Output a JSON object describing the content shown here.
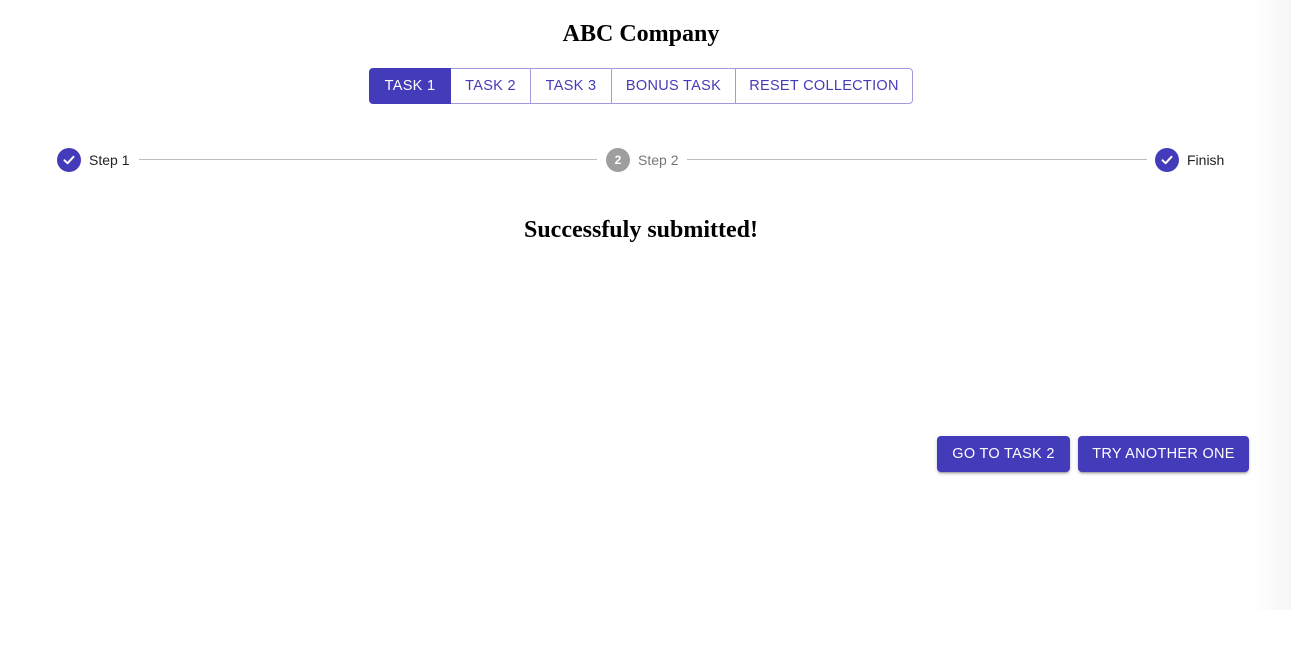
{
  "header": {
    "title": "ABC Company"
  },
  "tabs": [
    {
      "label": "TASK 1",
      "active": true
    },
    {
      "label": "TASK 2",
      "active": false
    },
    {
      "label": "TASK 3",
      "active": false
    },
    {
      "label": "BONUS TASK",
      "active": false
    },
    {
      "label": "RESET COLLECTION",
      "active": false
    }
  ],
  "stepper": {
    "steps": [
      {
        "label": "Step 1",
        "state": "completed",
        "icon": "check-icon"
      },
      {
        "label": "Step 2",
        "state": "pending",
        "number": "2"
      },
      {
        "label": "Finish",
        "state": "completed",
        "icon": "check-icon"
      }
    ]
  },
  "main": {
    "message": "Successfuly submitted!"
  },
  "actions": {
    "go_to_task_label": "GO TO TASK 2",
    "try_another_label": "TRY ANOTHER ONE"
  },
  "colors": {
    "primary": "#443bba",
    "pending_step": "#9e9e9e",
    "connector": "#bdbdbd"
  }
}
